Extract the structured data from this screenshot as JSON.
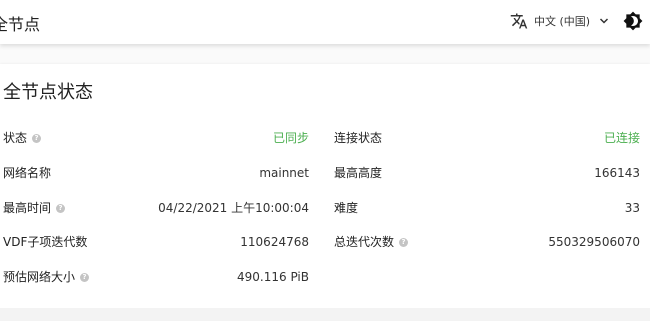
{
  "appbar": {
    "title": "全节点",
    "language": "中文 (中国)",
    "icons": {
      "language": "translate-icon",
      "dropdown": "chevron-down-icon",
      "theme": "brightness-icon"
    }
  },
  "card": {
    "title": "全节点状态",
    "left_rows": [
      {
        "label": "状态",
        "value": "已同步",
        "help": true
      },
      {
        "label": "网络名称",
        "value": "mainnet",
        "help": false
      },
      {
        "label": "最高时间",
        "value": "04/22/2021 上午10:00:04",
        "help": true
      },
      {
        "label": "VDF子项迭代数",
        "value": "110624768",
        "help": false
      },
      {
        "label": "预估网络大小",
        "value": "490.116 PiB",
        "help": true
      }
    ],
    "right_rows": [
      {
        "label": "连接状态",
        "value": "已连接",
        "help": false
      },
      {
        "label": "最高高度",
        "value": "166143",
        "help": false
      },
      {
        "label": "难度",
        "value": "33",
        "help": false
      },
      {
        "label": "总迭代次数",
        "value": "550329506070",
        "help": true
      }
    ]
  },
  "colors": {
    "ok": "#4caf50",
    "text": "#212121",
    "background": "#fafafa"
  }
}
